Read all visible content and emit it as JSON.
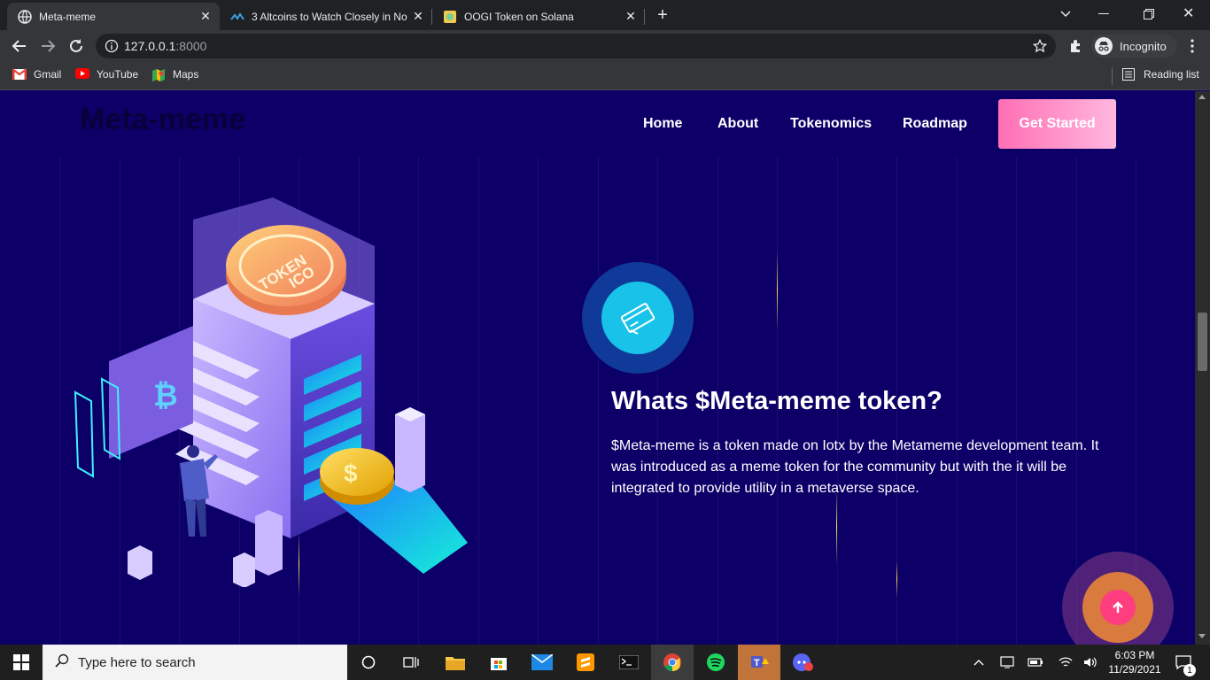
{
  "browser": {
    "tabs": [
      {
        "title": "Meta-meme",
        "active": true
      },
      {
        "title": "3 Altcoins to Watch Closely in No",
        "active": false
      },
      {
        "title": "OOGI Token on Solana",
        "active": false
      }
    ],
    "url_host": "127.0.0.1",
    "url_port": ":8000",
    "profile_label": "Incognito",
    "bookmarks": [
      "Gmail",
      "YouTube",
      "Maps"
    ],
    "reading_list": "Reading list"
  },
  "site": {
    "logo": "Meta-meme",
    "nav": [
      "Home",
      "About",
      "Tokenomics",
      "Roadmap"
    ],
    "cta": "Get Started",
    "heading": "Whats $Meta-meme token?",
    "description": "$Meta-meme is a token made on Iotx by the Metameme development team. It was introduced as a meme token for the community but with the it will be integrated to provide utility in a metaverse space.",
    "coin_text_top": "TOKEN",
    "coin_text_bottom": "ICO"
  },
  "taskbar": {
    "search_placeholder": "Type here to search",
    "time": "6:03 PM",
    "date": "11/29/2021",
    "notification_count": "1"
  },
  "colors": {
    "page_bg": "#0c0068",
    "cta_gradient_start": "#ff6fb5",
    "accent_cyan": "#19c2e8",
    "scroll_top_button": "#ff3d7f"
  }
}
